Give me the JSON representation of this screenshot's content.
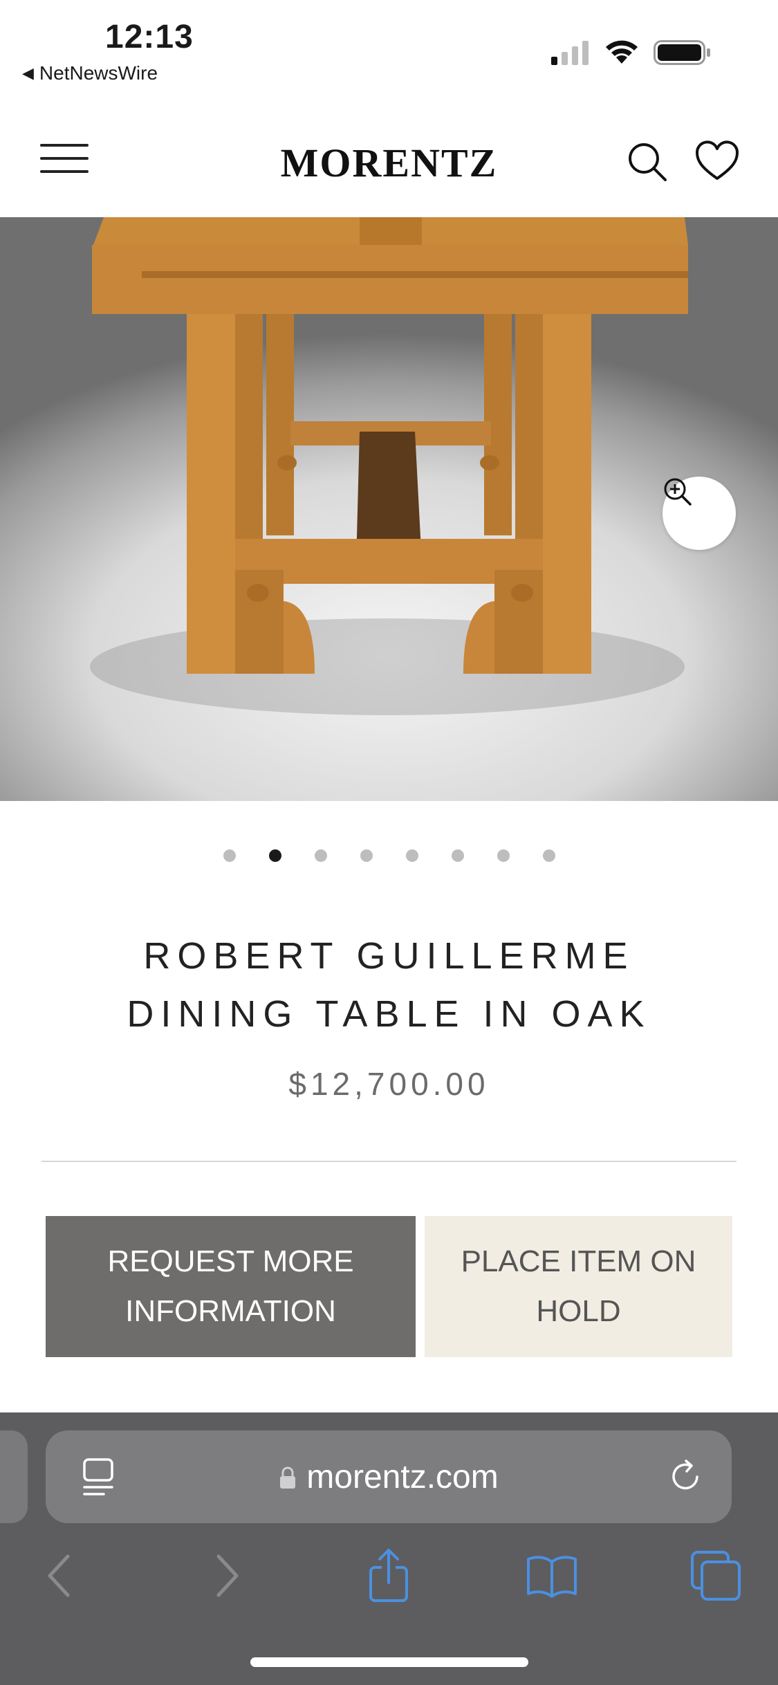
{
  "status_bar": {
    "time": "12:13",
    "back_app": "NetNewsWire",
    "icons": [
      "cellular-signal-icon",
      "wifi-icon",
      "battery-icon"
    ]
  },
  "header": {
    "logo": "MORENTZ",
    "icons": [
      "hamburger-menu-icon",
      "search-icon",
      "heart-icon"
    ]
  },
  "hero": {
    "image": "oak-dining-table-photo",
    "zoom_icon": "zoom-in-icon"
  },
  "carousel": {
    "total": 8,
    "active_index": 1
  },
  "product": {
    "title_line1": "ROBERT GUILLERME",
    "title_line2": "DINING TABLE IN OAK",
    "price": "$12,700.00"
  },
  "actions": {
    "request_line1": "REQUEST MORE",
    "request_line2": "INFORMATION",
    "hold_line1": "PLACE ITEM ON",
    "hold_line2": "HOLD"
  },
  "browser": {
    "url": "morentz.com",
    "icons": [
      "reader-icon",
      "lock-icon",
      "reload-icon",
      "back-icon",
      "forward-icon",
      "share-icon",
      "bookmarks-icon",
      "tabs-icon"
    ]
  },
  "colors": {
    "request_button_bg": "#6e6d6b",
    "hold_button_bg": "#f1ede3",
    "browser_bar_bg": "#5d5d5f",
    "toolbar_accent": "#4a90e2"
  }
}
